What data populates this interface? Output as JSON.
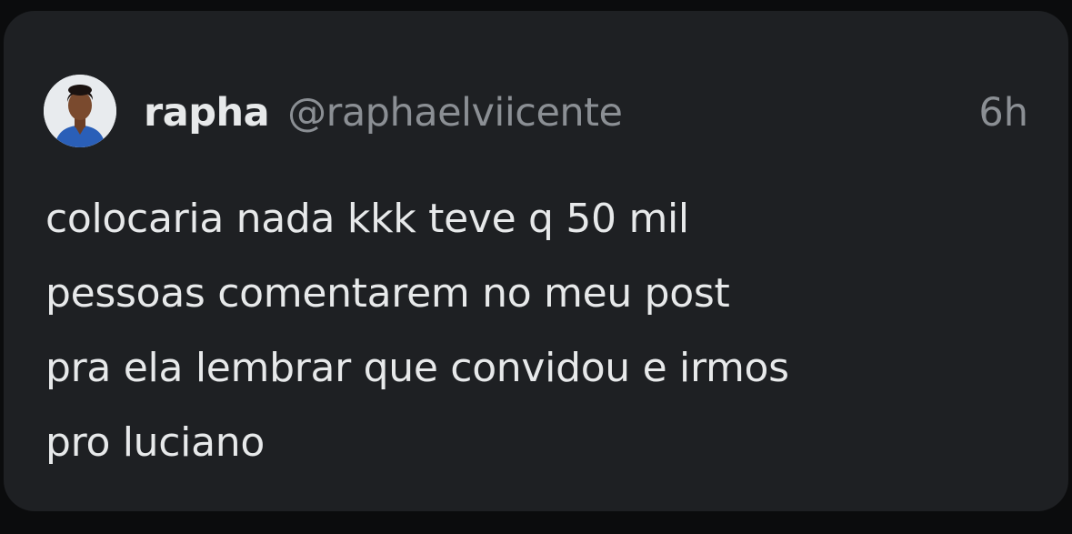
{
  "post": {
    "author": {
      "display_name": "rapha",
      "handle": "@raphaelviicente",
      "avatar_icon": "user-avatar"
    },
    "timestamp": "6h",
    "text_lines": [
      "colocaria nada kkk teve q 50 mil",
      "pessoas comentarem no meu post",
      "pra ela lembrar que convidou e irmos",
      "pro luciano"
    ]
  },
  "colors": {
    "background": "#0b0c0d",
    "card": "#1e2023",
    "primary_text": "#e7e9ea",
    "secondary_text": "#8b8f94"
  }
}
